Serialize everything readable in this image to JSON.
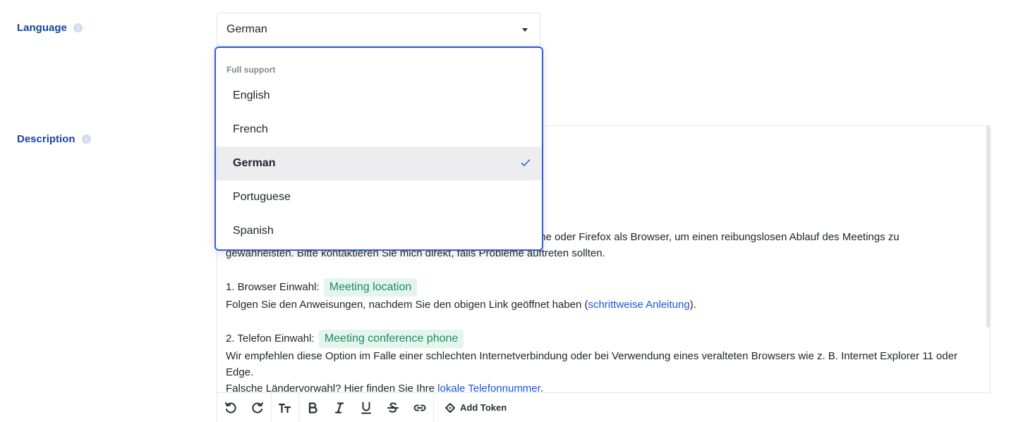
{
  "language_field": {
    "label": "Language",
    "selected_value": "German",
    "dropdown": {
      "group_label": "Full support",
      "options": [
        {
          "label": "English",
          "selected": false
        },
        {
          "label": "French",
          "selected": false
        },
        {
          "label": "German",
          "selected": true
        },
        {
          "label": "Portuguese",
          "selected": false
        },
        {
          "label": "Spanish",
          "selected": false
        }
      ]
    }
  },
  "description_field": {
    "label": "Description",
    "line1_visible": "me oder Firefox als Browser, um einen reibungslosen Ablauf des Meetings zu",
    "line2": "gewährleisten. Bitte kontaktieren Sie mich direkt, falls Probleme auftreten sollten.",
    "browser_prefix": "1. Browser Einwahl:",
    "browser_token": "Meeting location",
    "browser_follow": "Folgen Sie den Anweisungen, nachdem Sie den obigen Link geöffnet haben (",
    "browser_link": "schrittweise Anleitung",
    "browser_follow_end": ").",
    "phone_prefix": "2. Telefon Einwahl:",
    "phone_token": "Meeting conference phone",
    "phone_recommend": "Wir empfehlen diese Option im Falle einer schlechten Internetverbindung oder bei Verwendung eines veralteten Browsers wie z. B. Internet Explorer 11 oder",
    "phone_recommend_end": "Edge.",
    "wrong_code": "Falsche Ländervorwahl? Hier finden Sie Ihre ",
    "local_link": "lokale Telefonnummer",
    "wrong_code_end": "."
  },
  "toolbar": {
    "add_token_label": "Add Token"
  },
  "colors": {
    "label": "#17459c",
    "accent": "#2f5de0",
    "link": "#1d56d8",
    "token_bg": "#e3f5ee",
    "token_text": "#1e8a62"
  },
  "icons": [
    "info-icon",
    "chevron-down-icon",
    "check-icon",
    "undo-icon",
    "redo-icon",
    "text-size-icon",
    "bold-icon",
    "italic-icon",
    "underline-icon",
    "strikethrough-icon",
    "link-icon",
    "token-icon"
  ]
}
